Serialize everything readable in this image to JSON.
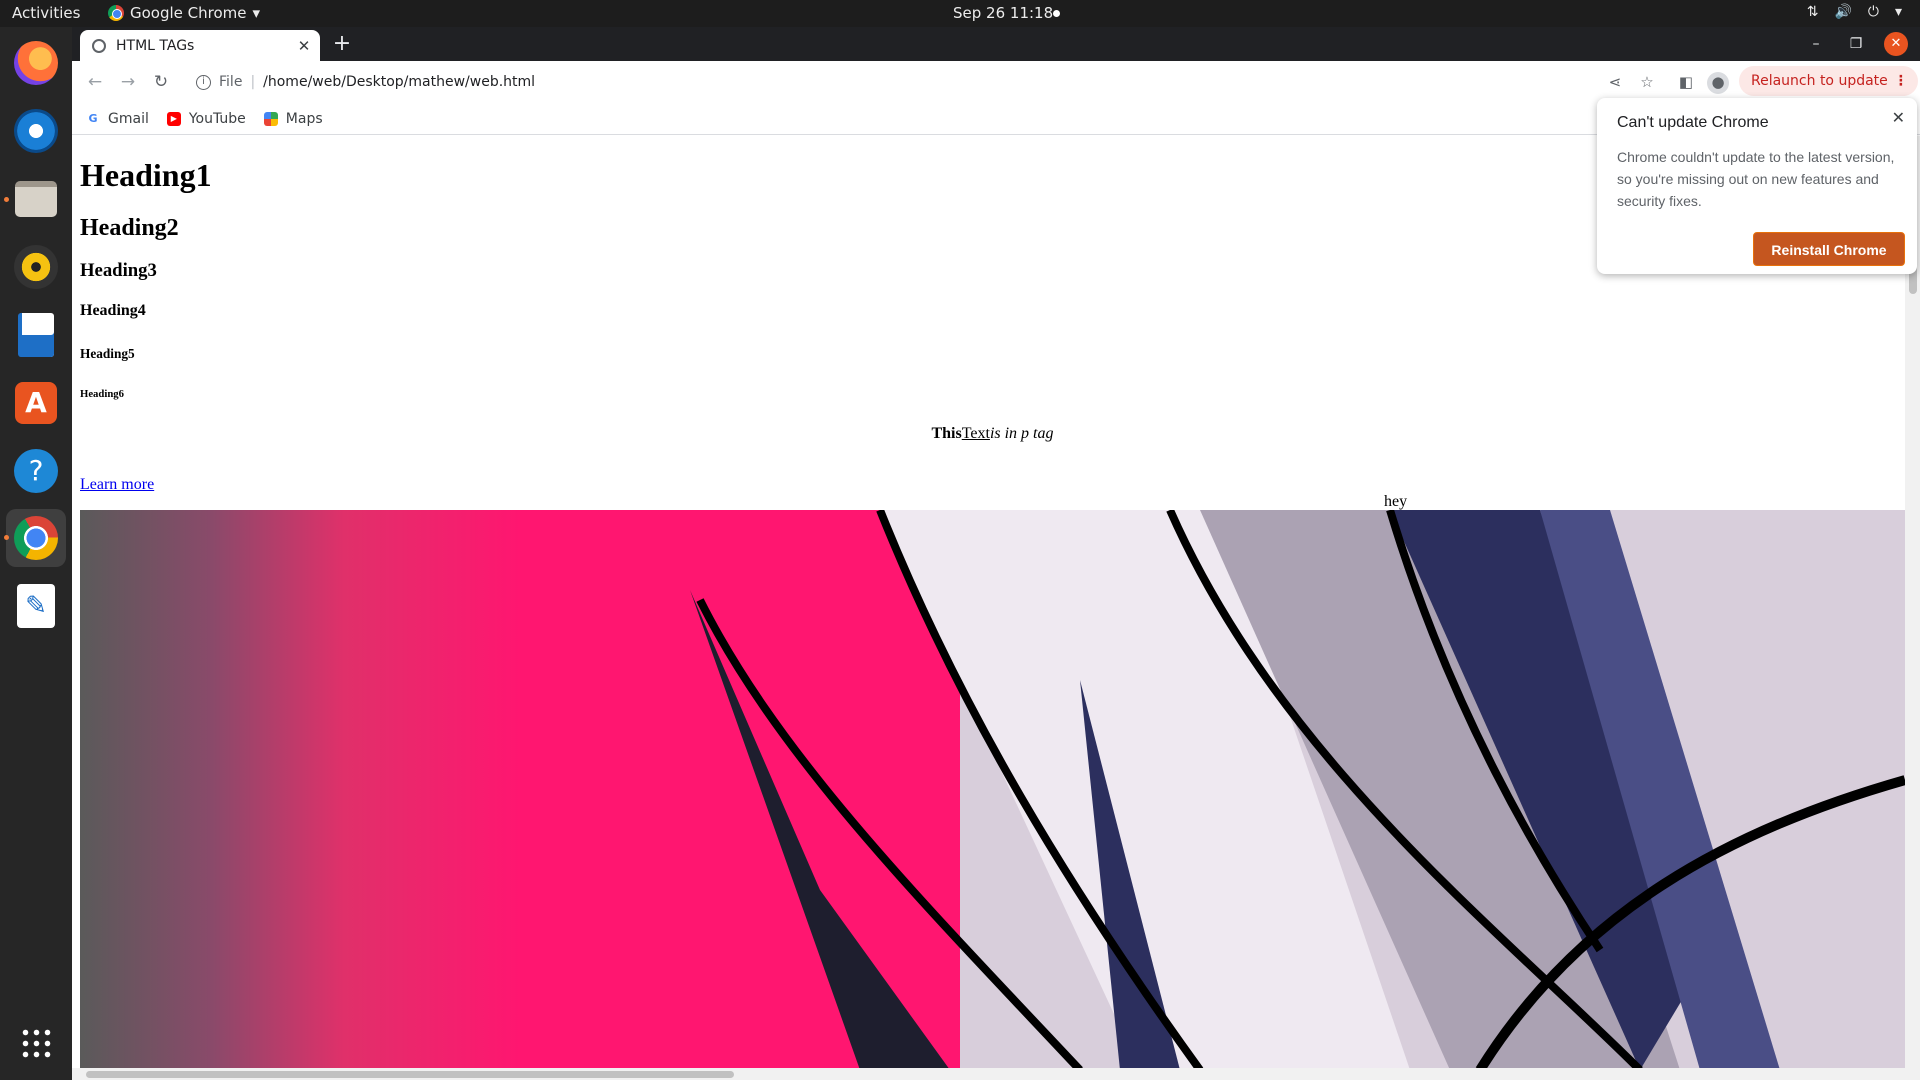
{
  "topbar": {
    "activities": "Activities",
    "app_name": "Google Chrome",
    "app_menu_arrow": "▾",
    "clock": "Sep 26  11:18"
  },
  "dock": {
    "items": [
      "firefox-icon",
      "thunderbird-icon",
      "files-icon",
      "rhythmbox-icon",
      "writer-icon",
      "software-icon",
      "help-icon",
      "chrome-icon",
      "text-editor-icon",
      "app-grid-icon"
    ]
  },
  "browser": {
    "tab_title": "HTML TAGs",
    "url_scheme": "File",
    "url_path": "/home/web/Desktop/mathew/web.html",
    "relaunch_label": "Relaunch to update",
    "bookmarks": [
      "Gmail",
      "YouTube",
      "Maps"
    ]
  },
  "page": {
    "h1": "Heading1",
    "h2": "Heading2",
    "h3": "Heading3",
    "h4": "Heading4",
    "h5": "Heading5",
    "h6": "Heading6",
    "p_bold": "This",
    "p_text": "Text",
    "p_italic": "is in p tag",
    "learn_more": "Learn more",
    "hey": "hey"
  },
  "popup": {
    "title": "Can't update Chrome",
    "body": "Chrome couldn't update to the latest version, so you're missing out on new features and security fixes.",
    "button": "Reinstall Chrome"
  },
  "colors": {
    "accent_orange": "#e95420",
    "relaunch_bg": "#fce8e6",
    "relaunch_text": "#c5221f",
    "link": "#0000ee"
  }
}
